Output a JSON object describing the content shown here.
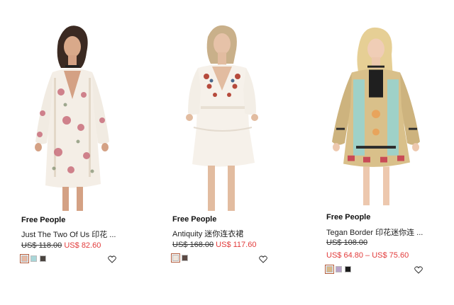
{
  "products": [
    {
      "brand": "Free People",
      "name": "Just The Two Of Us 印花 ...",
      "price_original": "US$ 118.00",
      "price_sale": "US$ 82.60",
      "swatches": [
        "#e6b9a4",
        "#a8d6d8",
        "#4a4440"
      ],
      "selected_swatch": 0,
      "wishlist_icon": "heart-outline-icon"
    },
    {
      "brand": "Free People",
      "name": "Antiquity 迷你连衣裙",
      "price_original": "US$ 168.00",
      "price_sale": "US$ 117.60",
      "swatches": [
        "#efe6dc",
        "#5b4a45"
      ],
      "selected_swatch": 0,
      "wishlist_icon": "heart-outline-icon"
    },
    {
      "brand": "Free People",
      "name": "Tegan Border 印花迷你连 ...",
      "price_original": "US$ 108.00",
      "price_sale": "US$ 64.80 – US$ 75.60",
      "swatches": [
        "#d8b98a",
        "#b9a3c9",
        "#1c1c1c"
      ],
      "selected_swatch": 0,
      "wishlist_icon": "heart-outline-icon"
    }
  ]
}
